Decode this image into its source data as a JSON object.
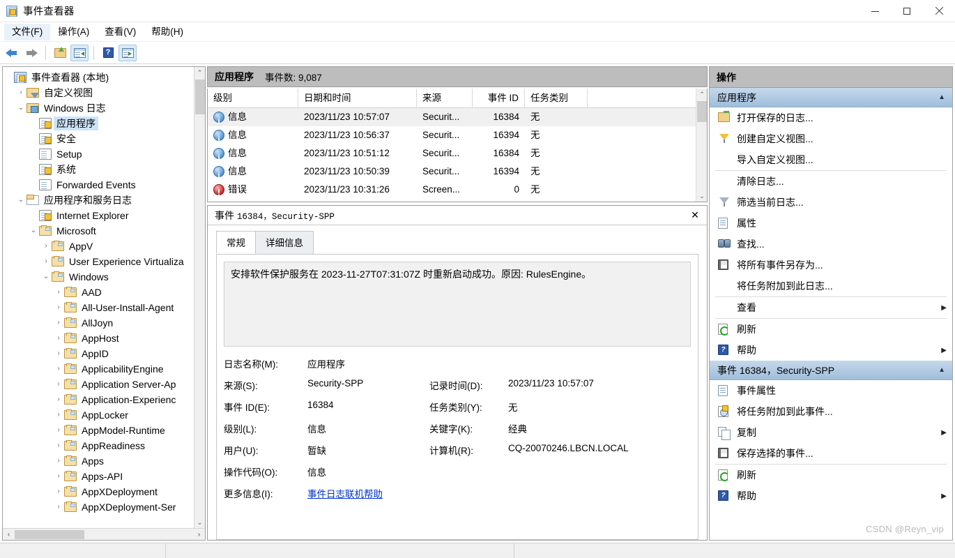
{
  "window": {
    "title": "事件查看器",
    "icon": "event-viewer-icon",
    "minimize": "—",
    "maximize": "▢",
    "close": "✕"
  },
  "menubar": {
    "items": [
      {
        "label": "文件(F)"
      },
      {
        "label": "操作(A)"
      },
      {
        "label": "查看(V)"
      },
      {
        "label": "帮助(H)"
      }
    ]
  },
  "toolbar": {
    "buttons": [
      {
        "name": "back-icon",
        "framed": false
      },
      {
        "name": "forward-icon",
        "framed": false
      },
      {
        "name": "open-folder-icon",
        "framed": false
      },
      {
        "name": "show-hide-tree-pane-icon",
        "framed": true
      },
      {
        "name": "help-icon",
        "framed": false
      },
      {
        "name": "show-hide-action-pane-icon",
        "framed": true
      }
    ]
  },
  "tree": {
    "nodes": [
      {
        "label": "事件查看器 (本地)",
        "indent": 0,
        "twist": "",
        "icon": "event-viewer-icon",
        "selected": false
      },
      {
        "label": "自定义视图",
        "indent": 1,
        "twist": "›",
        "icon": "custom-view-icon",
        "selected": false
      },
      {
        "label": "Windows 日志",
        "indent": 1,
        "twist": "⌄",
        "icon": "windows-logs-icon",
        "selected": false
      },
      {
        "label": "应用程序",
        "indent": 2,
        "twist": "",
        "icon": "log-warn-icon",
        "selected": true
      },
      {
        "label": "安全",
        "indent": 2,
        "twist": "",
        "icon": "log-warn-icon",
        "selected": false
      },
      {
        "label": "Setup",
        "indent": 2,
        "twist": "",
        "icon": "log-icon",
        "selected": false
      },
      {
        "label": "系统",
        "indent": 2,
        "twist": "",
        "icon": "log-warn-icon",
        "selected": false
      },
      {
        "label": "Forwarded Events",
        "indent": 2,
        "twist": "",
        "icon": "log-icon",
        "selected": false
      },
      {
        "label": "应用程序和服务日志",
        "indent": 1,
        "twist": "⌄",
        "icon": "app-service-logs-icon",
        "selected": false
      },
      {
        "label": "Internet Explorer",
        "indent": 2,
        "twist": "",
        "icon": "log-warn-icon",
        "selected": false
      },
      {
        "label": "Microsoft",
        "indent": 2,
        "twist": "⌄",
        "icon": "folder-icon",
        "selected": false
      },
      {
        "label": "AppV",
        "indent": 3,
        "twist": "›",
        "icon": "folder-icon",
        "selected": false
      },
      {
        "label": "User Experience Virtualiza",
        "indent": 3,
        "twist": "›",
        "icon": "folder-icon",
        "selected": false
      },
      {
        "label": "Windows",
        "indent": 3,
        "twist": "⌄",
        "icon": "folder-icon",
        "selected": false
      },
      {
        "label": "AAD",
        "indent": 4,
        "twist": "›",
        "icon": "folder-icon",
        "selected": false
      },
      {
        "label": "All-User-Install-Agent",
        "indent": 4,
        "twist": "›",
        "icon": "folder-icon",
        "selected": false
      },
      {
        "label": "AllJoyn",
        "indent": 4,
        "twist": "›",
        "icon": "folder-icon",
        "selected": false
      },
      {
        "label": "AppHost",
        "indent": 4,
        "twist": "›",
        "icon": "folder-icon",
        "selected": false
      },
      {
        "label": "AppID",
        "indent": 4,
        "twist": "›",
        "icon": "folder-icon",
        "selected": false
      },
      {
        "label": "ApplicabilityEngine",
        "indent": 4,
        "twist": "›",
        "icon": "folder-icon",
        "selected": false
      },
      {
        "label": "Application Server-Ap",
        "indent": 4,
        "twist": "›",
        "icon": "folder-icon",
        "selected": false
      },
      {
        "label": "Application-Experienc",
        "indent": 4,
        "twist": "›",
        "icon": "folder-icon",
        "selected": false
      },
      {
        "label": "AppLocker",
        "indent": 4,
        "twist": "›",
        "icon": "folder-icon",
        "selected": false
      },
      {
        "label": "AppModel-Runtime",
        "indent": 4,
        "twist": "›",
        "icon": "folder-icon",
        "selected": false
      },
      {
        "label": "AppReadiness",
        "indent": 4,
        "twist": "›",
        "icon": "folder-icon",
        "selected": false
      },
      {
        "label": "Apps",
        "indent": 4,
        "twist": "›",
        "icon": "folder-icon",
        "selected": false
      },
      {
        "label": "Apps-API",
        "indent": 4,
        "twist": "›",
        "icon": "folder-icon",
        "selected": false
      },
      {
        "label": "AppXDeployment",
        "indent": 4,
        "twist": "›",
        "icon": "folder-icon",
        "selected": false
      },
      {
        "label": "AppXDeployment-Ser",
        "indent": 4,
        "twist": "›",
        "icon": "folder-icon",
        "selected": false
      }
    ]
  },
  "center": {
    "log_name": "应用程序",
    "event_count_label": "事件数: 9,087",
    "columns": [
      {
        "key": "level",
        "label": "级别"
      },
      {
        "key": "date",
        "label": "日期和时间"
      },
      {
        "key": "source",
        "label": "来源"
      },
      {
        "key": "id",
        "label": "事件 ID"
      },
      {
        "key": "task",
        "label": "任务类别"
      }
    ],
    "rows": [
      {
        "level": "信息",
        "level_icon": "information-icon",
        "date": "2023/11/23 10:57:07",
        "source": "Securit...",
        "id": "16384",
        "task": "无",
        "selected": true
      },
      {
        "level": "信息",
        "level_icon": "information-icon",
        "date": "2023/11/23 10:56:37",
        "source": "Securit...",
        "id": "16394",
        "task": "无",
        "selected": false
      },
      {
        "level": "信息",
        "level_icon": "information-icon",
        "date": "2023/11/23 10:51:12",
        "source": "Securit...",
        "id": "16384",
        "task": "无",
        "selected": false
      },
      {
        "level": "信息",
        "level_icon": "information-icon",
        "date": "2023/11/23 10:50:39",
        "source": "Securit...",
        "id": "16394",
        "task": "无",
        "selected": false
      },
      {
        "level": "错误",
        "level_icon": "error-icon",
        "date": "2023/11/23 10:31:26",
        "source": "Screen...",
        "id": "0",
        "task": "无",
        "selected": false
      }
    ]
  },
  "detail": {
    "title_prefix": "事件",
    "title_id": "16384，Security-SPP",
    "close": "✕",
    "tabs": [
      {
        "label": "常规",
        "active": true
      },
      {
        "label": "详细信息",
        "active": false
      }
    ],
    "message": "安排软件保护服务在 2023-11-27T07:31:07Z 时重新启动成功。原因: RulesEngine。",
    "fields": {
      "log_name_label": "日志名称(M):",
      "log_name_value": "应用程序",
      "source_label": "来源(S):",
      "source_value": "Security-SPP",
      "logged_label": "记录时间(D):",
      "logged_value": "2023/11/23 10:57:07",
      "event_id_label": "事件 ID(E):",
      "event_id_value": "16384",
      "task_category_label": "任务类别(Y):",
      "task_category_value": "无",
      "level_label": "级别(L):",
      "level_value": "信息",
      "keywords_label": "关键字(K):",
      "keywords_value": "经典",
      "user_label": "用户(U):",
      "user_value": "暂缺",
      "computer_label": "计算机(R):",
      "computer_value": "CQ-20070246.LBCN.LOCAL",
      "opcode_label": "操作代码(O):",
      "opcode_value": "信息",
      "more_info_label": "更多信息(I):",
      "more_info_link": "事件日志联机帮助"
    }
  },
  "actions": {
    "title": "操作",
    "groups": [
      {
        "header": "应用程序",
        "caret": "▲",
        "items": [
          {
            "label": "打开保存的日志...",
            "icon": "open-saved-log-icon",
            "submenu": "",
            "separator_after": false
          },
          {
            "label": "创建自定义视图...",
            "icon": "create-custom-view-icon",
            "submenu": "",
            "separator_after": false
          },
          {
            "label": "导入自定义视图...",
            "icon": "none",
            "submenu": "",
            "separator_after": true
          },
          {
            "label": "清除日志...",
            "icon": "none",
            "submenu": "",
            "separator_after": false
          },
          {
            "label": "筛选当前日志...",
            "icon": "filter-icon",
            "submenu": "",
            "separator_after": false
          },
          {
            "label": "属性",
            "icon": "properties-icon",
            "submenu": "",
            "separator_after": false
          },
          {
            "label": "查找...",
            "icon": "find-icon",
            "submenu": "",
            "separator_after": false
          },
          {
            "label": "将所有事件另存为...",
            "icon": "save-icon",
            "submenu": "",
            "separator_after": false
          },
          {
            "label": "将任务附加到此日志...",
            "icon": "none",
            "submenu": "",
            "separator_after": true
          },
          {
            "label": "查看",
            "icon": "none",
            "submenu": "▶",
            "separator_after": true
          },
          {
            "label": "刷新",
            "icon": "refresh-icon",
            "submenu": "",
            "separator_after": false
          },
          {
            "label": "帮助",
            "icon": "help-icon",
            "submenu": "▶",
            "separator_after": false
          }
        ]
      },
      {
        "header": "事件 16384，Security-SPP",
        "caret": "▲",
        "items": [
          {
            "label": "事件属性",
            "icon": "properties-icon",
            "submenu": "",
            "separator_after": false
          },
          {
            "label": "将任务附加到此事件...",
            "icon": "attach-task-icon",
            "submenu": "",
            "separator_after": false
          },
          {
            "label": "复制",
            "icon": "copy-icon",
            "submenu": "▶",
            "separator_after": false
          },
          {
            "label": "保存选择的事件...",
            "icon": "save-icon",
            "submenu": "",
            "separator_after": true
          },
          {
            "label": "刷新",
            "icon": "refresh-icon",
            "submenu": "",
            "separator_after": false
          },
          {
            "label": "帮助",
            "icon": "help-icon",
            "submenu": "▶",
            "separator_after": false
          }
        ]
      }
    ]
  },
  "watermark": "CSDN @Reyn_vip"
}
